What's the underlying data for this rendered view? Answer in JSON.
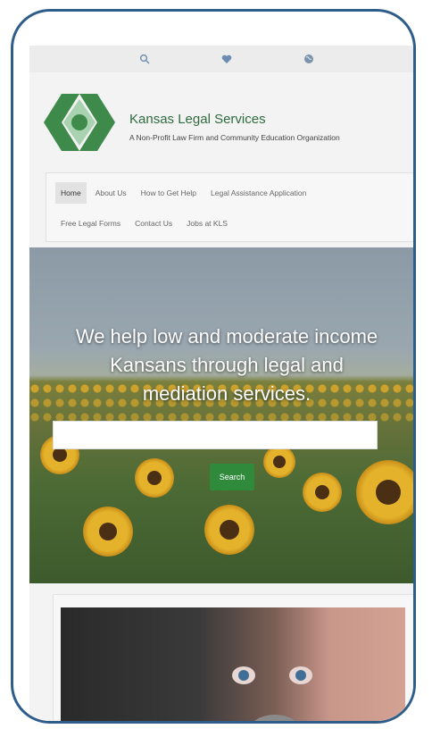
{
  "utility_bar": {
    "icons": [
      "search-icon",
      "heart-icon",
      "globe-icon"
    ]
  },
  "header": {
    "title": "Kansas Legal Services",
    "tagline": "A Non-Profit Law Firm and Community Education Organization"
  },
  "nav": {
    "row1": [
      {
        "label": "Home",
        "active": true
      },
      {
        "label": "About Us"
      },
      {
        "label": "How to Get Help"
      },
      {
        "label": "Legal Assistance Application"
      }
    ],
    "row2": [
      {
        "label": "Free Legal Forms"
      },
      {
        "label": "Contact Us"
      },
      {
        "label": "Jobs at KLS"
      }
    ]
  },
  "hero": {
    "headline_line1": "We help low and moderate income",
    "headline_line2": "Kansans through legal and",
    "headline_line3": "mediation services.",
    "search_placeholder": "",
    "search_button_label": "Search"
  },
  "colors": {
    "frame": "#2f5d8a",
    "brand_green": "#2f6b3f",
    "button_green": "#2f8a3c"
  }
}
